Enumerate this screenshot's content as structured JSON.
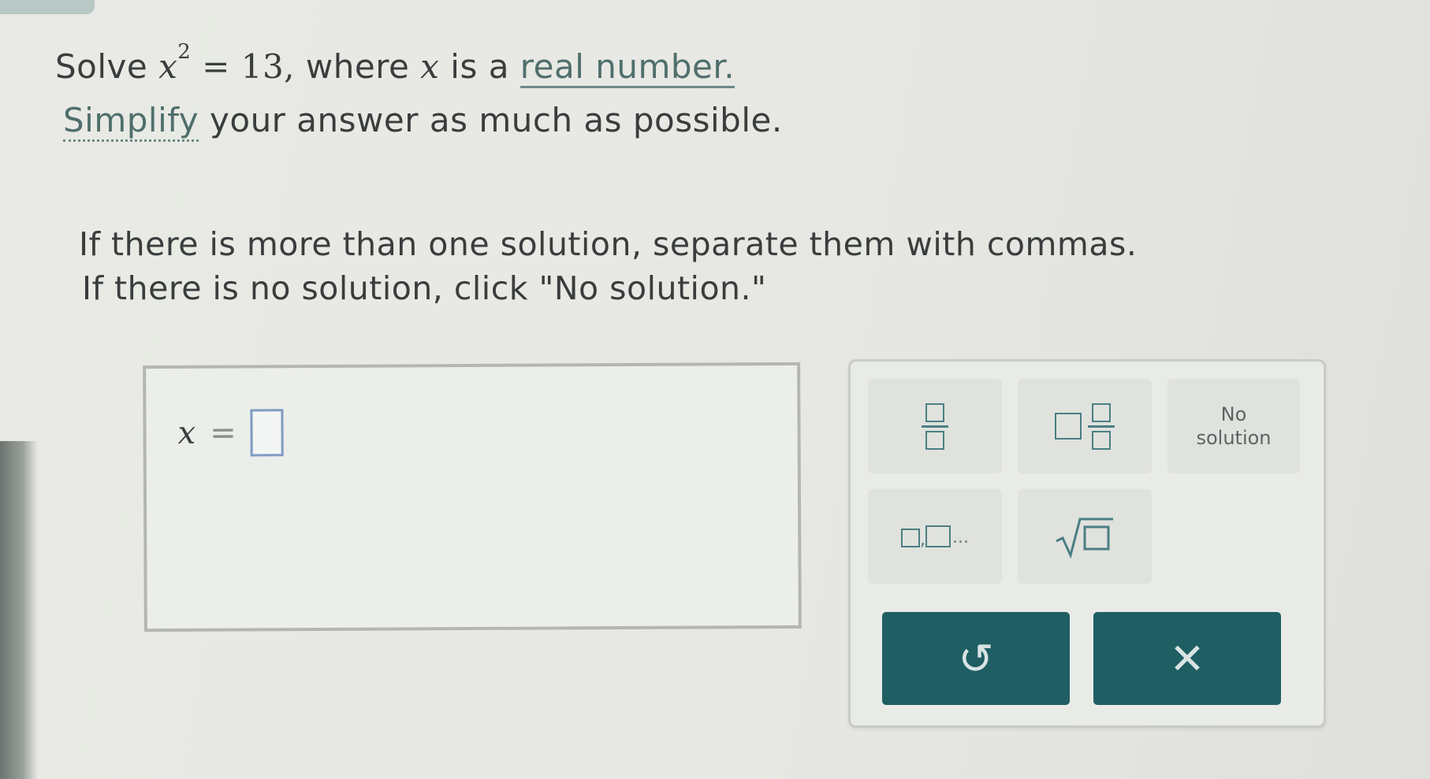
{
  "problem": {
    "solve_word": "Solve",
    "eq_var": "x",
    "eq_exp": "2",
    "eq_rhs": "= 13,",
    "where_text": "where",
    "where_var": "x",
    "is_a": "is a",
    "real_number_link": "real number.",
    "simplify_link": "Simplify",
    "simplify_rest": "your answer as much as possible.",
    "instruction_1": "If there is more than one solution, separate them with commas.",
    "instruction_2": "If there is no solution, click \"No solution.\""
  },
  "answer": {
    "variable": "x",
    "equals": "=",
    "value": ""
  },
  "keypad": {
    "no_solution_line1": "No",
    "no_solution_line2": "solution",
    "list_ellipsis": "...",
    "undo_glyph": "↺",
    "clear_glyph": "✕"
  },
  "colors": {
    "button_bg": "#1f5e63",
    "link": "#4f6f6c",
    "input_border": "#7f9bc2"
  }
}
